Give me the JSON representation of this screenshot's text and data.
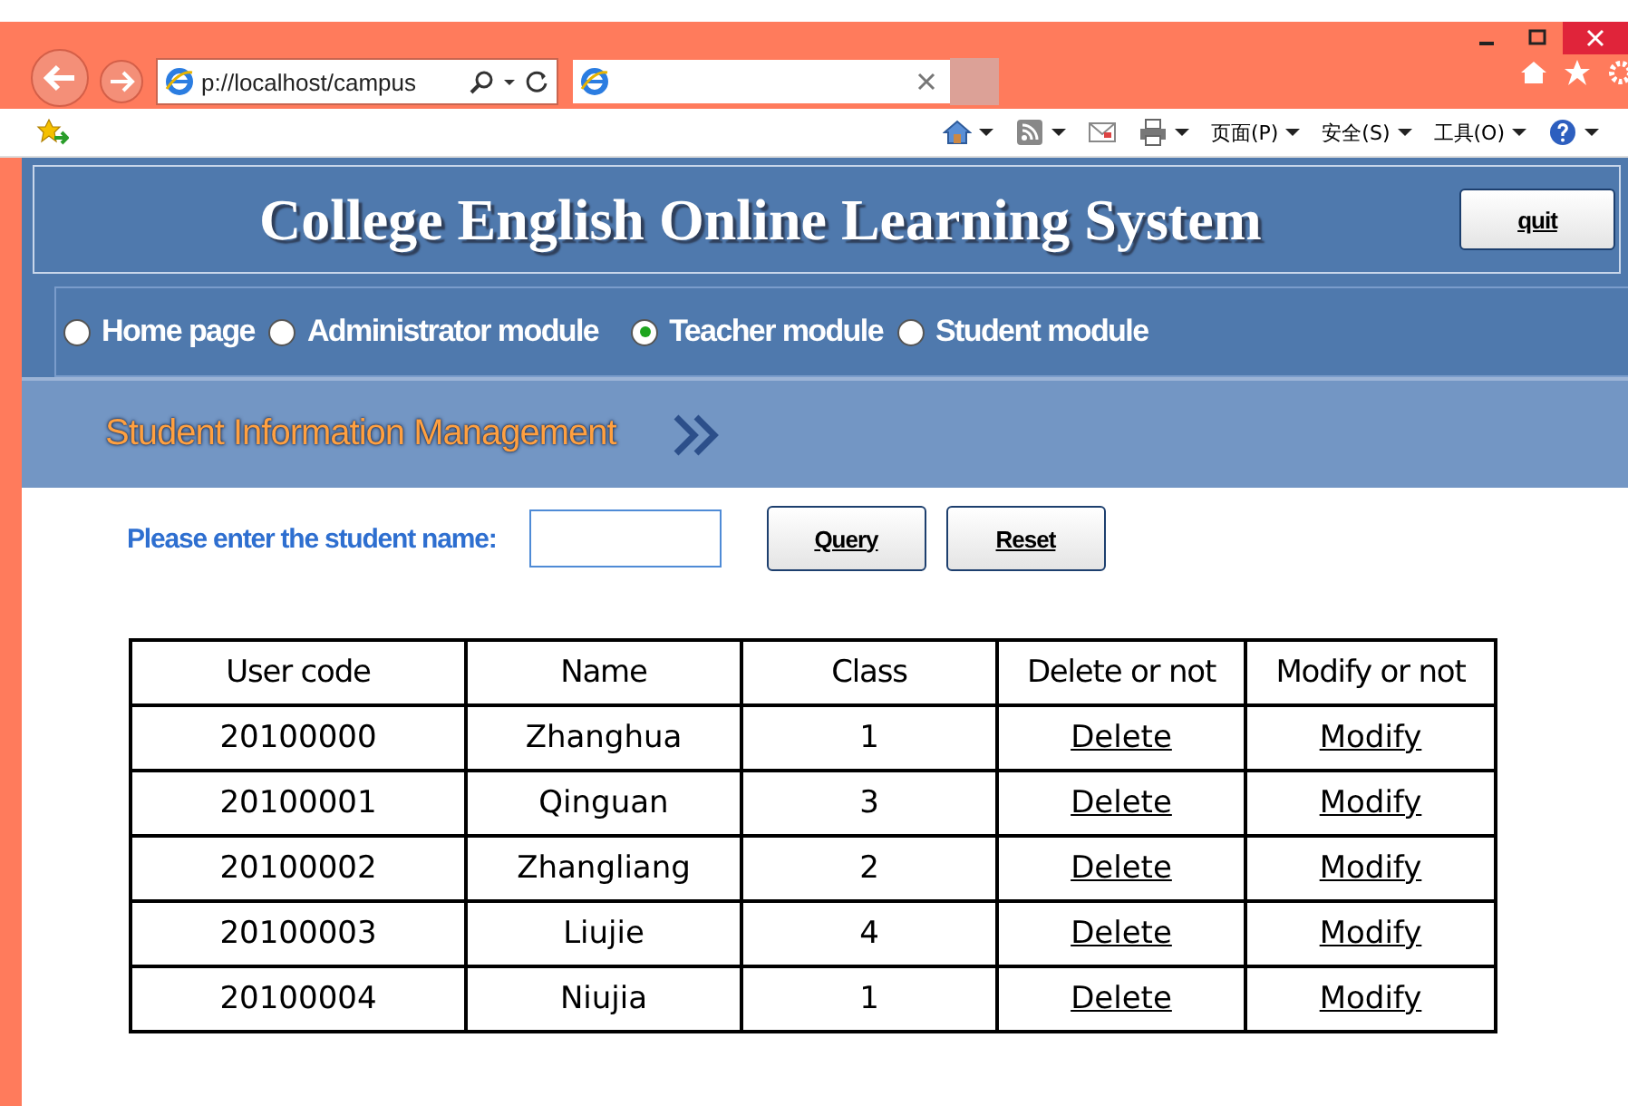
{
  "browser": {
    "address": "p://localhost/campus",
    "command_bar": [
      {
        "kind": "home"
      },
      {
        "kind": "feed"
      },
      {
        "kind": "mail"
      },
      {
        "kind": "print"
      },
      {
        "kind": "text",
        "label": "页面(P)"
      },
      {
        "kind": "text",
        "label": "安全(S)"
      },
      {
        "kind": "text",
        "label": "工具(O)"
      },
      {
        "kind": "help"
      }
    ]
  },
  "header": {
    "title": "College English Online Learning System",
    "quit_button": "quit"
  },
  "modules": [
    {
      "label": "Home page",
      "selected": false
    },
    {
      "label": "Administrator module",
      "selected": false
    },
    {
      "label": "Teacher module",
      "selected": true
    },
    {
      "label": "Student module",
      "selected": false
    }
  ],
  "section_title": "Student Information Management",
  "search": {
    "label": "Please enter the student name:",
    "buttons": [
      "Query",
      "Reset"
    ]
  },
  "table": {
    "columns": [
      "User code",
      "Name",
      "Class",
      "Delete or not",
      "Modify or not"
    ],
    "rows": [
      [
        "20100000",
        "Zhanghua",
        "1",
        "Delete",
        "Modify"
      ],
      [
        "20100001",
        "Qinguan",
        "3",
        "Delete",
        "Modify"
      ],
      [
        "20100002",
        "Zhangliang",
        "2",
        "Delete",
        "Modify"
      ],
      [
        "20100003",
        "Liujie",
        "4",
        "Delete",
        "Modify"
      ],
      [
        "20100004",
        "Niujia",
        "1",
        "Delete",
        "Modify"
      ]
    ]
  }
}
